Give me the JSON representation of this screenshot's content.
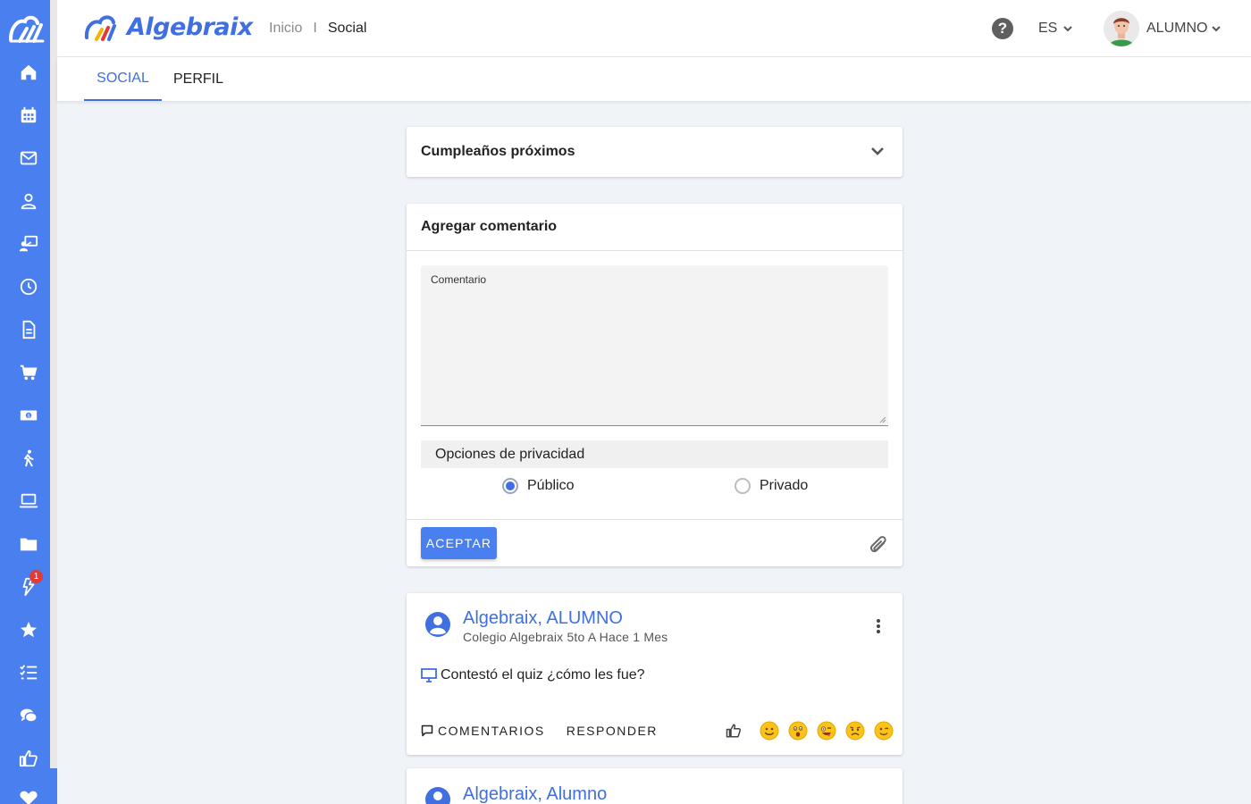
{
  "header": {
    "brand": "Algebraix",
    "breadcrumb": {
      "home": "Inicio",
      "separator": "I",
      "current": "Social"
    },
    "language": "ES",
    "user": "ALUMNO"
  },
  "tabs": [
    {
      "label": "SOCIAL",
      "active": true
    },
    {
      "label": "PERFIL",
      "active": false
    }
  ],
  "sidebar": {
    "items": [
      "home-icon",
      "calendar-icon",
      "mail-icon",
      "user-icon",
      "classroom-icon",
      "clock-icon",
      "document-icon",
      "cart-icon",
      "money-icon",
      "activity-icon",
      "laptop-icon",
      "folder-icon",
      "bolt-icon",
      "star-icon",
      "checklist-icon",
      "chat-icon",
      "thumbs-up-icon",
      "heart-icon"
    ],
    "notification_badge": "1"
  },
  "birthdays": {
    "title": "Cumpleaños próximos"
  },
  "comment_form": {
    "title": "Agregar comentario",
    "textarea_label": "Comentario",
    "textarea_value": "",
    "privacy_title": "Opciones de privacidad",
    "options": [
      {
        "label": "Público",
        "selected": true
      },
      {
        "label": "Privado",
        "selected": false
      }
    ],
    "submit": "ACEPTAR"
  },
  "posts": [
    {
      "author": "Algebraix, ALUMNO",
      "meta": "Colegio Algebraix 5to A Hace 1 Mes",
      "body": "Contestó el quiz ¿cómo les fue?",
      "actions": {
        "comments": "COMENTARIOS",
        "reply": "RESPONDER"
      }
    },
    {
      "author": "Algebraix, Alumno"
    }
  ],
  "colors": {
    "primary": "#4a7ff0",
    "link": "#3f6fe0",
    "background": "#f0f4f9",
    "badge": "#e53935"
  }
}
